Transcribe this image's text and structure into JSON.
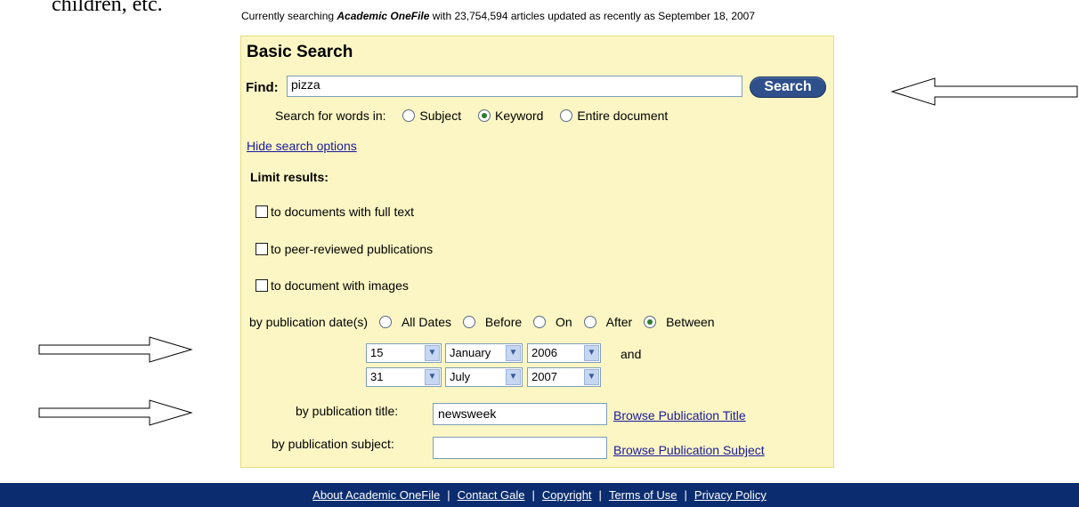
{
  "doc_fragment": "children, etc.",
  "status": {
    "prefix": "Currently searching",
    "db_name": "Academic OneFile",
    "suffix": "with 23,754,594 articles updated as recently as September 18, 2007"
  },
  "search": {
    "title": "Basic Search",
    "find_label": "Find:",
    "query": "pizza",
    "button_label": "Search",
    "search_in_label": "Search for words in:",
    "search_in_options": [
      {
        "label": "Subject",
        "selected": false
      },
      {
        "label": "Keyword",
        "selected": true
      },
      {
        "label": "Entire document",
        "selected": false
      }
    ],
    "hide_options_link": "Hide search options"
  },
  "limits": {
    "heading": "Limit results:",
    "full_text": "to documents with full text",
    "peer_reviewed": "to peer-reviewed publications",
    "images": "to document with images",
    "date_label": "by publication date(s)",
    "date_options": [
      {
        "label": "All Dates",
        "selected": false
      },
      {
        "label": "Before",
        "selected": false
      },
      {
        "label": "On",
        "selected": false
      },
      {
        "label": "After",
        "selected": false
      },
      {
        "label": "Between",
        "selected": true
      }
    ],
    "from": {
      "day": "15",
      "month": "January",
      "year": "2006"
    },
    "and_label": "and",
    "to": {
      "day": "31",
      "month": "July",
      "year": "2007"
    },
    "pub_title_label": "by publication title:",
    "pub_title_value": "newsweek",
    "browse_title_link": "Browse Publication Title",
    "pub_subject_label": "by publication subject:",
    "pub_subject_value": "",
    "browse_subject_link": "Browse Publication Subject"
  },
  "footer": {
    "links": [
      "About Academic OneFile",
      "Contact Gale",
      "Copyright",
      "Terms of Use",
      "Privacy Policy"
    ]
  },
  "colors": {
    "panel_bg": "#fbf6c4",
    "panel_border": "#e8dc7a",
    "search_button": "#2e4f8a",
    "footer_bg": "#0b2d6f",
    "link": "#1a1a9c"
  }
}
